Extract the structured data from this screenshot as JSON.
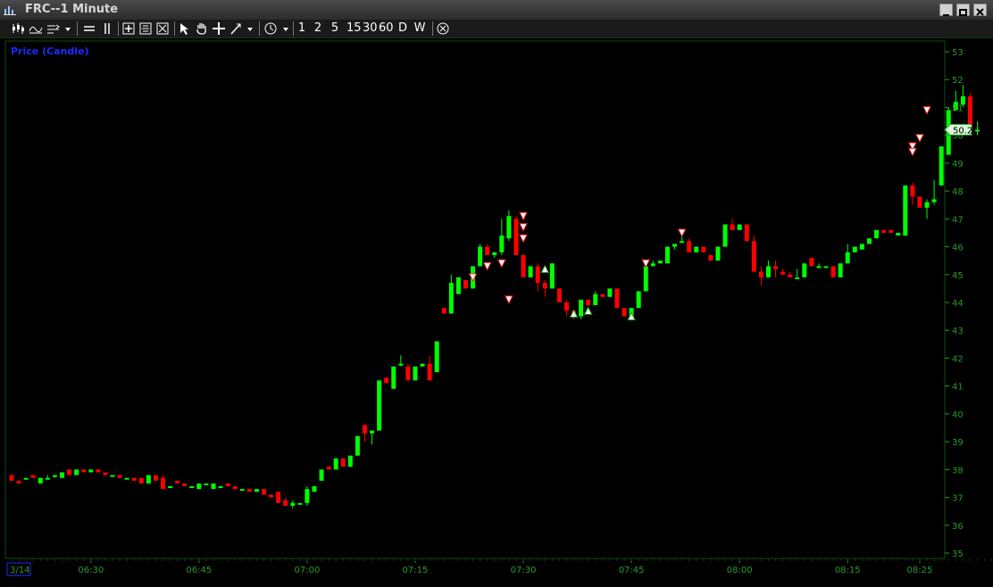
{
  "window": {
    "title": "FRC--1 Minute"
  },
  "toolbar": {
    "periods": [
      "1",
      "2",
      "5",
      "15",
      "30",
      "60",
      "D",
      "W"
    ]
  },
  "colors": {
    "background": "#000000",
    "up": "#00ff00",
    "down": "#ff0000",
    "axis_text": "#2a9a2a",
    "gridline": "#0f4a0f",
    "legend": "#1a2cff"
  },
  "chart_data": {
    "type": "candlestick",
    "title": "Price (Candle)",
    "ylim": [
      35,
      53
    ],
    "y_ticks": [
      35,
      36,
      37,
      38,
      39,
      40,
      41,
      42,
      43,
      44,
      45,
      46,
      47,
      48,
      49,
      50,
      51,
      52,
      53
    ],
    "x_start_time": "06:19",
    "x_tick_labels": [
      "3/14",
      "06:30",
      "06:45",
      "07:00",
      "07:15",
      "07:30",
      "07:45",
      "08:00",
      "08:15",
      "08:25"
    ],
    "last_price_label": "50.2",
    "interval": "1 Minute",
    "candles": [
      [
        37.8,
        37.8,
        37.6,
        37.6
      ],
      [
        37.6,
        37.6,
        37.5,
        37.5
      ],
      [
        37.7,
        37.7,
        37.7,
        37.7
      ],
      [
        37.8,
        37.8,
        37.7,
        37.7
      ],
      [
        37.5,
        37.7,
        37.5,
        37.7
      ],
      [
        37.7,
        37.8,
        37.7,
        37.7
      ],
      [
        37.8,
        37.8,
        37.7,
        37.8
      ],
      [
        37.7,
        37.9,
        37.7,
        37.9
      ],
      [
        38.0,
        38.0,
        37.8,
        37.8
      ],
      [
        37.8,
        38.0,
        37.8,
        38.0
      ],
      [
        38.0,
        38.0,
        37.9,
        37.9
      ],
      [
        37.9,
        38.0,
        37.9,
        38.0
      ],
      [
        38.0,
        38.0,
        37.9,
        37.9
      ],
      [
        37.9,
        37.9,
        37.8,
        37.8
      ],
      [
        37.8,
        37.8,
        37.8,
        37.8
      ],
      [
        37.8,
        37.8,
        37.7,
        37.7
      ],
      [
        37.7,
        37.7,
        37.7,
        37.7
      ],
      [
        37.7,
        37.7,
        37.6,
        37.6
      ],
      [
        37.7,
        37.7,
        37.5,
        37.5
      ],
      [
        37.5,
        37.8,
        37.5,
        37.8
      ],
      [
        37.8,
        37.8,
        37.6,
        37.6
      ],
      [
        37.7,
        37.8,
        37.3,
        37.3
      ],
      [
        37.4,
        37.4,
        37.4,
        37.4
      ],
      [
        37.6,
        37.6,
        37.5,
        37.5
      ],
      [
        37.5,
        37.5,
        37.4,
        37.4
      ],
      [
        37.4,
        37.4,
        37.4,
        37.4
      ],
      [
        37.3,
        37.5,
        37.3,
        37.5
      ],
      [
        37.5,
        37.5,
        37.5,
        37.5
      ],
      [
        37.3,
        37.5,
        37.3,
        37.5
      ],
      [
        37.4,
        37.4,
        37.4,
        37.4
      ],
      [
        37.5,
        37.5,
        37.4,
        37.4
      ],
      [
        37.4,
        37.4,
        37.3,
        37.3
      ],
      [
        37.3,
        37.3,
        37.3,
        37.3
      ],
      [
        37.3,
        37.3,
        37.2,
        37.2
      ],
      [
        37.2,
        37.3,
        37.2,
        37.3
      ],
      [
        37.3,
        37.3,
        37.1,
        37.1
      ],
      [
        37.1,
        37.1,
        37.0,
        37.0
      ],
      [
        37.2,
        37.2,
        36.8,
        36.8
      ],
      [
        36.9,
        37.0,
        36.7,
        36.7
      ],
      [
        36.7,
        36.9,
        36.6,
        36.8
      ],
      [
        36.8,
        36.8,
        36.8,
        36.8
      ],
      [
        36.8,
        37.4,
        36.7,
        37.3
      ],
      [
        37.2,
        37.4,
        37.2,
        37.4
      ],
      [
        37.6,
        38.0,
        37.6,
        38.0
      ],
      [
        38.1,
        38.1,
        38.0,
        38.0
      ],
      [
        38.0,
        38.4,
        38.0,
        38.4
      ],
      [
        38.4,
        38.4,
        38.1,
        38.1
      ],
      [
        38.1,
        38.5,
        38.1,
        38.5
      ],
      [
        38.5,
        39.2,
        38.5,
        39.2
      ],
      [
        39.6,
        39.6,
        39.0,
        39.3
      ],
      [
        39.3,
        39.4,
        38.9,
        39.4
      ],
      [
        39.4,
        41.2,
        39.4,
        41.2
      ],
      [
        41.3,
        41.3,
        41.1,
        41.1
      ],
      [
        40.9,
        41.7,
        40.9,
        41.7
      ],
      [
        41.8,
        42.1,
        41.7,
        41.8
      ],
      [
        41.7,
        41.8,
        41.2,
        41.2
      ],
      [
        41.2,
        41.7,
        41.2,
        41.7
      ],
      [
        41.7,
        41.8,
        41.7,
        41.8
      ],
      [
        41.8,
        42.1,
        41.2,
        41.2
      ],
      [
        41.5,
        42.6,
        41.5,
        42.6
      ],
      [
        43.8,
        43.8,
        43.6,
        43.6
      ],
      [
        43.6,
        45.0,
        43.6,
        44.7
      ],
      [
        44.3,
        44.9,
        44.3,
        44.9
      ],
      [
        44.8,
        44.8,
        44.5,
        44.5
      ],
      [
        44.5,
        45.3,
        44.5,
        45.3
      ],
      [
        45.3,
        46.1,
        45.3,
        46.0
      ],
      [
        46.0,
        46.1,
        45.7,
        45.7
      ],
      [
        45.7,
        45.8,
        45.6,
        45.8
      ],
      [
        45.8,
        47.0,
        45.7,
        46.4
      ],
      [
        46.3,
        47.3,
        46.2,
        47.1
      ],
      [
        47.0,
        47.1,
        45.7,
        45.7
      ],
      [
        45.7,
        45.7,
        44.9,
        44.9
      ],
      [
        44.9,
        45.3,
        44.9,
        45.3
      ],
      [
        45.3,
        45.4,
        44.4,
        44.7
      ],
      [
        44.7,
        44.8,
        44.2,
        44.5
      ],
      [
        44.5,
        45.4,
        44.5,
        45.4
      ],
      [
        44.5,
        44.5,
        44.0,
        44.0
      ],
      [
        44.0,
        44.1,
        43.5,
        43.7
      ],
      [
        43.7,
        43.7,
        43.4,
        43.5
      ],
      [
        43.5,
        44.1,
        43.4,
        44.1
      ],
      [
        44.1,
        44.1,
        43.9,
        43.9
      ],
      [
        43.9,
        44.4,
        43.9,
        44.3
      ],
      [
        44.3,
        44.3,
        44.2,
        44.2
      ],
      [
        44.2,
        44.5,
        44.2,
        44.5
      ],
      [
        44.5,
        44.5,
        43.8,
        43.8
      ],
      [
        43.8,
        43.8,
        43.5,
        43.5
      ],
      [
        43.5,
        43.8,
        43.5,
        43.8
      ],
      [
        43.8,
        44.4,
        43.8,
        44.4
      ],
      [
        44.4,
        45.3,
        44.4,
        45.3
      ],
      [
        45.3,
        45.5,
        45.3,
        45.4
      ],
      [
        45.4,
        45.5,
        45.4,
        45.5
      ],
      [
        45.4,
        46.0,
        45.4,
        46.0
      ],
      [
        46.0,
        46.1,
        45.9,
        46.1
      ],
      [
        46.2,
        46.5,
        46.2,
        46.2
      ],
      [
        46.2,
        46.3,
        45.8,
        45.8
      ],
      [
        45.8,
        46.0,
        45.8,
        46.0
      ],
      [
        46.0,
        46.0,
        45.8,
        45.8
      ],
      [
        45.7,
        45.7,
        45.5,
        45.5
      ],
      [
        45.5,
        46.0,
        45.5,
        46.0
      ],
      [
        46.0,
        46.8,
        46.0,
        46.8
      ],
      [
        46.8,
        47.0,
        46.6,
        46.6
      ],
      [
        46.6,
        46.8,
        46.6,
        46.8
      ],
      [
        46.8,
        46.8,
        46.2,
        46.2
      ],
      [
        46.2,
        46.4,
        45.1,
        45.1
      ],
      [
        45.1,
        45.3,
        44.6,
        44.9
      ],
      [
        44.9,
        45.5,
        44.9,
        45.3
      ],
      [
        45.3,
        45.5,
        44.9,
        45.2
      ],
      [
        45.1,
        45.2,
        45.0,
        45.0
      ],
      [
        45.0,
        45.1,
        44.9,
        44.9
      ],
      [
        44.9,
        45.2,
        44.9,
        44.9
      ],
      [
        44.9,
        45.4,
        44.9,
        45.4
      ],
      [
        45.6,
        45.6,
        45.3,
        45.3
      ],
      [
        45.3,
        45.4,
        45.3,
        45.3
      ],
      [
        45.3,
        45.3,
        45.3,
        45.3
      ],
      [
        45.3,
        45.3,
        44.9,
        44.9
      ],
      [
        44.9,
        45.4,
        44.9,
        45.4
      ],
      [
        45.4,
        46.1,
        45.4,
        45.8
      ],
      [
        45.8,
        46.0,
        45.8,
        46.0
      ],
      [
        45.9,
        46.1,
        45.9,
        46.1
      ],
      [
        46.1,
        46.3,
        46.1,
        46.3
      ],
      [
        46.3,
        46.6,
        46.3,
        46.6
      ],
      [
        46.6,
        46.6,
        46.5,
        46.5
      ],
      [
        46.6,
        46.6,
        46.5,
        46.5
      ],
      [
        46.4,
        46.5,
        46.4,
        46.5
      ],
      [
        46.4,
        48.2,
        46.4,
        48.2
      ],
      [
        48.2,
        48.3,
        47.5,
        47.8
      ],
      [
        47.8,
        47.8,
        47.4,
        47.4
      ],
      [
        47.4,
        47.7,
        47.0,
        47.6
      ],
      [
        47.6,
        48.4,
        47.5,
        47.7
      ],
      [
        48.2,
        49.6,
        48.2,
        49.6
      ],
      [
        49.3,
        51.0,
        49.3,
        50.9
      ],
      [
        50.9,
        51.6,
        50.9,
        51.2
      ],
      [
        51.1,
        51.8,
        51.0,
        51.4
      ],
      [
        51.4,
        51.5,
        50.0,
        50.2
      ],
      [
        50.2,
        50.5,
        50.0,
        50.2
      ]
    ],
    "signals": [
      {
        "i": 69,
        "y": 44.1,
        "type": "sell"
      },
      {
        "i": 68,
        "y": 45.4,
        "type": "sell"
      },
      {
        "i": 66,
        "y": 45.3,
        "type": "sell"
      },
      {
        "i": 64,
        "y": 44.9,
        "type": "sell"
      },
      {
        "i": 71,
        "y": 47.1,
        "type": "sell"
      },
      {
        "i": 71,
        "y": 46.7,
        "type": "sell"
      },
      {
        "i": 71,
        "y": 46.3,
        "type": "sell"
      },
      {
        "i": 74,
        "y": 45.2,
        "type": "buy"
      },
      {
        "i": 78,
        "y": 43.6,
        "type": "buy"
      },
      {
        "i": 80,
        "y": 43.7,
        "type": "buy"
      },
      {
        "i": 86,
        "y": 43.5,
        "type": "buy"
      },
      {
        "i": 88,
        "y": 45.4,
        "type": "sell"
      },
      {
        "i": 93,
        "y": 46.5,
        "type": "sell"
      },
      {
        "i": 125,
        "y": 49.6,
        "type": "sell"
      },
      {
        "i": 125,
        "y": 49.4,
        "type": "sell"
      },
      {
        "i": 126,
        "y": 49.9,
        "type": "sell"
      },
      {
        "i": 127,
        "y": 50.9,
        "type": "sell"
      }
    ]
  }
}
